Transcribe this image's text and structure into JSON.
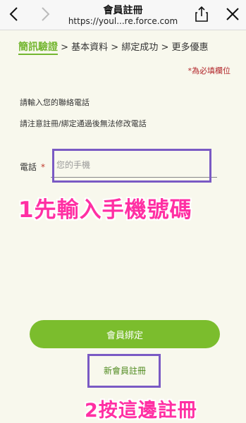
{
  "browser": {
    "title": "會員註冊",
    "url": "https://youl...re.force.com"
  },
  "steps": {
    "active": "簡訊驗證",
    "rest": " > 基本資料 > 綁定成功 > 更多優惠"
  },
  "required_note": "*為必填欄位",
  "instructions": {
    "line1": "請輸入您的聯絡電話",
    "line2": "請注意註冊/綁定通過後無法修改電話"
  },
  "phone": {
    "label": "電話",
    "required_mark": "*",
    "placeholder": "您的手機",
    "value": ""
  },
  "annotations": {
    "step1": "1先輸入手機號碼",
    "step2": "2按這邊註冊"
  },
  "buttons": {
    "bind": "會員綁定",
    "register": "新會員註冊"
  },
  "colors": {
    "accent_green": "#7bbd2d",
    "highlight_purple": "#7a5ac4",
    "annotation_pink": "#ff2fa3",
    "required_red": "#b2262b"
  }
}
